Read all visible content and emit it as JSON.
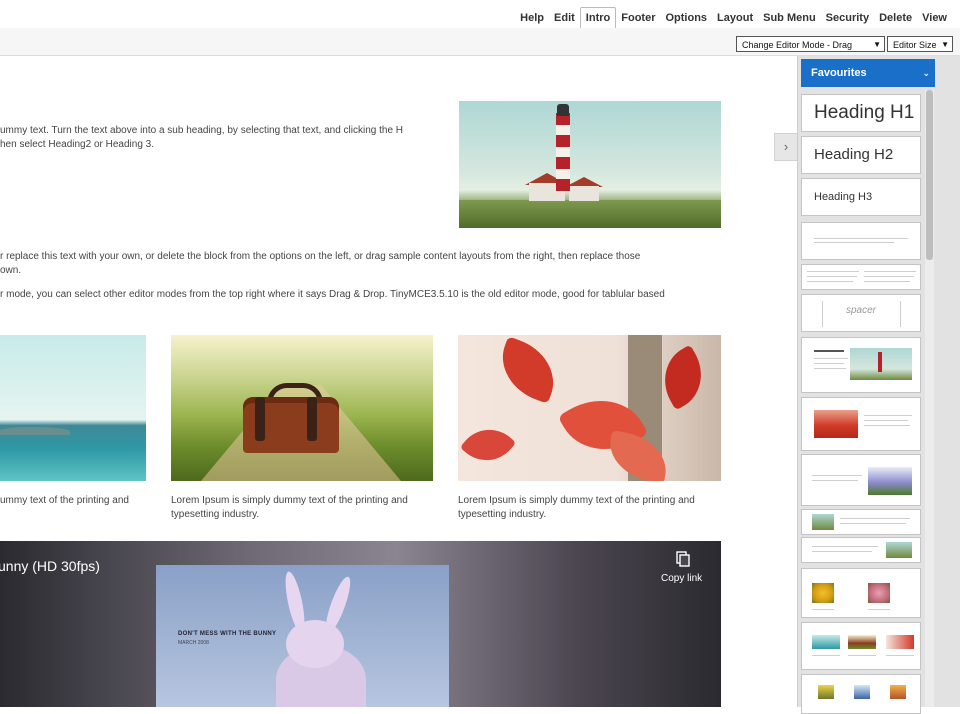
{
  "menu": {
    "items": [
      "Help",
      "Edit",
      "Intro",
      "Footer",
      "Options",
      "Layout",
      "Sub Menu",
      "Security",
      "Delete",
      "View"
    ],
    "active": "Intro"
  },
  "toolbar": {
    "editor_mode": "Change Editor Mode - Drag Drop",
    "editor_size": "Editor Size"
  },
  "content": {
    "para1_line1": "ummy text. Turn the text above into a sub heading, by selecting that text, and clicking the H",
    "para1_line2": "hen select Heading2 or Heading 3.",
    "para2_line1": "r replace this text with your own, or delete the block from the options on the left, or drag sample content layouts from the right, then replace those",
    "para2_line2": "own.",
    "para3_line1": "r mode, you can select other editor modes from the top right where it says Drag & Drop. TinyMCE3.5.10 is the old editor mode, good for tablular based",
    "caption1": "ummy text of the printing and",
    "caption2_line1": "Lorem Ipsum is simply dummy text of the printing and",
    "caption2_line2": "typesetting industry.",
    "caption3_line1": "Lorem Ipsum is simply dummy text of the printing and",
    "caption3_line2": "typesetting industry.",
    "video_title": "unny (HD 30fps)",
    "video_screen_title": "DON'T MESS WITH THE BUNNY",
    "video_screen_sub": "MARCH 2008",
    "copy_link": "Copy link"
  },
  "panel": {
    "dropdown": "Favourites",
    "heading_h1": "Heading H1",
    "heading_h2": "Heading H2",
    "heading_h3": "Heading H3",
    "spacer": "spacer",
    "accent_color": "#1a6fc8"
  }
}
